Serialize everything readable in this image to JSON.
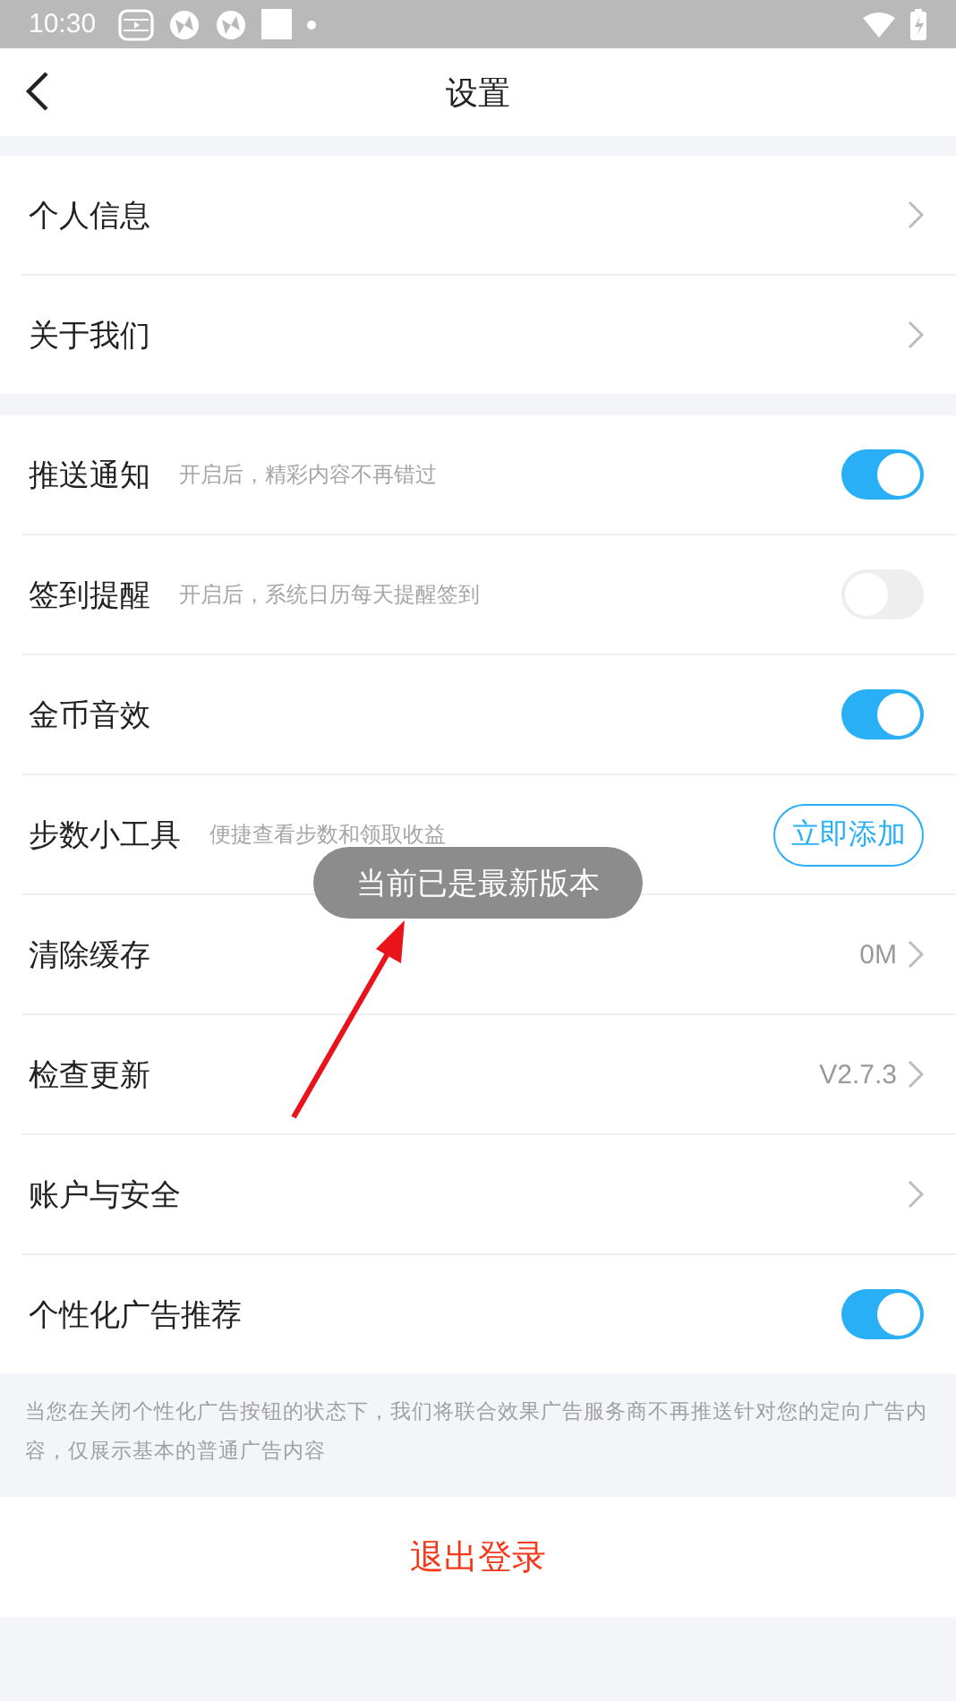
{
  "status_bar": {
    "time": "10:30"
  },
  "header": {
    "title": "设置"
  },
  "sections": [
    {
      "rows": [
        {
          "kind": "link",
          "label": "个人信息"
        },
        {
          "kind": "link",
          "label": "关于我们"
        }
      ]
    },
    {
      "rows": [
        {
          "kind": "toggle",
          "label": "推送通知",
          "hint": "开启后，精彩内容不再错过",
          "on": true
        },
        {
          "kind": "toggle",
          "label": "签到提醒",
          "hint": "开启后，系统日历每天提醒签到",
          "on": false
        },
        {
          "kind": "toggle",
          "label": "金币音效",
          "on": true
        },
        {
          "kind": "button",
          "label": "步数小工具",
          "hint": "便捷查看步数和领取收益",
          "button": "立即添加"
        },
        {
          "kind": "link",
          "label": "清除缓存",
          "value": "0M"
        },
        {
          "kind": "link",
          "label": "检查更新",
          "value": "V2.7.3"
        },
        {
          "kind": "link",
          "label": "账户与安全"
        },
        {
          "kind": "toggle",
          "label": "个性化广告推荐",
          "on": true
        }
      ]
    }
  ],
  "note": "当您在关闭个性化广告按钮的状态下，我们将联合效果广告服务商不再推送针对您的定向广告内容，仅展示基本的普通广告内容",
  "logout": "退出登录",
  "toast": "当前已是最新版本",
  "annotations": [
    {
      "kind": "arrow"
    }
  ]
}
